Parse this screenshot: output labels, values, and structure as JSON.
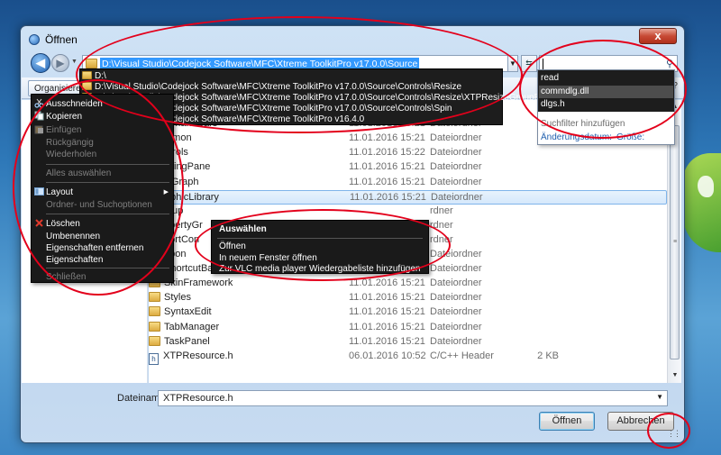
{
  "window": {
    "title": "Öffnen",
    "close_glyph": "x"
  },
  "address": {
    "path": "D:\\Visual Studio\\Codejock Software\\MFC\\Xtreme ToolkitPro v17.0.0\\Source",
    "history": [
      "D:\\",
      "D:\\Visual Studio\\Codejock Software\\MFC\\Xtreme ToolkitPro v17.0.0\\Source\\Controls\\Resize",
      "D:\\Visual Studio\\Codejock Software\\MFC\\Xtreme ToolkitPro v17.0.0\\Source\\Controls\\Resize\\XTPResizeGroupBox",
      "D:\\Visual Studio\\Codejock Software\\MFC\\Xtreme ToolkitPro v17.0.0\\Source\\Controls\\Spin",
      "D:\\Visual Studio\\Codejock Software\\MFC\\Xtreme ToolkitPro v16.4.0"
    ]
  },
  "search": {
    "value": "",
    "suggestions": [
      "read",
      "commdlg.dll",
      "dlgs.h"
    ],
    "highlighted_index": 1,
    "add_filter": "Suchfilter hinzufügen",
    "filters": [
      "Änderungsdatum:",
      "Größe:"
    ]
  },
  "toolbar": {
    "organize": "Organisieren"
  },
  "context_menu": {
    "items": [
      {
        "label": "Ausschneiden",
        "enabled": true,
        "icon": "scissors-icon"
      },
      {
        "label": "Kopieren",
        "enabled": true,
        "icon": "copy-icon"
      },
      {
        "label": "Einfügen",
        "enabled": false,
        "icon": "paste-icon"
      },
      {
        "label": "Rückgängig",
        "enabled": false
      },
      {
        "label": "Wiederholen",
        "enabled": false
      },
      {
        "label": "Alles auswählen",
        "enabled": false
      },
      {
        "label": "Layout",
        "enabled": true,
        "icon": "layout-icon",
        "submenu": true
      },
      {
        "label": "Ordner- und Suchoptionen",
        "enabled": false
      },
      {
        "label": "Löschen",
        "enabled": true,
        "icon": "delete-x-icon"
      },
      {
        "label": "Umbenennen",
        "enabled": true
      },
      {
        "label": "Eigenschaften entfernen",
        "enabled": true
      },
      {
        "label": "Eigenschaften",
        "enabled": true
      },
      {
        "label": "Schließen",
        "enabled": false
      }
    ]
  },
  "item_menu": {
    "header": "Auswählen",
    "items": [
      "Öffnen",
      "In neuem Fenster öffnen",
      "Zur VLC media player Wiedergabeliste hinzufügen"
    ]
  },
  "files": [
    {
      "name": "art",
      "date": "11.01.2016 15:21",
      "type": "Dateiordner",
      "size": "",
      "kind": "folder"
    },
    {
      "name": "mmandBars",
      "date": "11.01.2016 15:21",
      "type": "Dateiordner",
      "size": "",
      "kind": "folder"
    },
    {
      "name": "mmon",
      "date": "11.01.2016 15:21",
      "type": "Dateiordner",
      "size": "",
      "kind": "folder"
    },
    {
      "name": "ntrols",
      "date": "11.01.2016 15:22",
      "type": "Dateiordner",
      "size": "",
      "kind": "folder"
    },
    {
      "name": "ckingPane",
      "date": "11.01.2016 15:21",
      "type": "Dateiordner",
      "size": "",
      "kind": "folder"
    },
    {
      "name": "wGraph",
      "date": "11.01.2016 15:21",
      "type": "Dateiordner",
      "size": "",
      "kind": "folder"
    },
    {
      "name": "aphicLibrary",
      "date": "11.01.2016 15:21",
      "type": "Dateiordner",
      "size": "",
      "kind": "folder",
      "selected": true
    },
    {
      "name": "rkup",
      "date": "",
      "type": "rdner",
      "size": "",
      "kind": "folder"
    },
    {
      "name": "opertyGr",
      "date": "",
      "type": "rdner",
      "size": "",
      "kind": "folder"
    },
    {
      "name": "portCon",
      "date": "",
      "type": "rdner",
      "size": "",
      "kind": "folder"
    },
    {
      "name": "bbon",
      "date": "11.01.2016 15:21",
      "type": "Dateiordner",
      "size": "",
      "kind": "folder"
    },
    {
      "name": "ShortcutBar",
      "date": "11.01.2016 15:21",
      "type": "Dateiordner",
      "size": "",
      "kind": "folder"
    },
    {
      "name": "SkinFramework",
      "date": "11.01.2016 15:21",
      "type": "Dateiordner",
      "size": "",
      "kind": "folder"
    },
    {
      "name": "Styles",
      "date": "11.01.2016 15:21",
      "type": "Dateiordner",
      "size": "",
      "kind": "folder"
    },
    {
      "name": "SyntaxEdit",
      "date": "11.01.2016 15:21",
      "type": "Dateiordner",
      "size": "",
      "kind": "folder"
    },
    {
      "name": "TabManager",
      "date": "11.01.2016 15:21",
      "type": "Dateiordner",
      "size": "",
      "kind": "folder"
    },
    {
      "name": "TaskPanel",
      "date": "11.01.2016 15:21",
      "type": "Dateiordner",
      "size": "",
      "kind": "folder"
    },
    {
      "name": "XTPResource.h",
      "date": "06.01.2016 10:52",
      "type": "C/C++ Header",
      "size": "2 KB",
      "kind": "header"
    }
  ],
  "bottom": {
    "filename_label": "Dateiname:",
    "filename_value": "XTPResource.h",
    "open_label": "Öffnen",
    "cancel_label": "Abbrechen"
  },
  "colors": {
    "annotation": "#e3001b",
    "selection": "#3399ff"
  }
}
